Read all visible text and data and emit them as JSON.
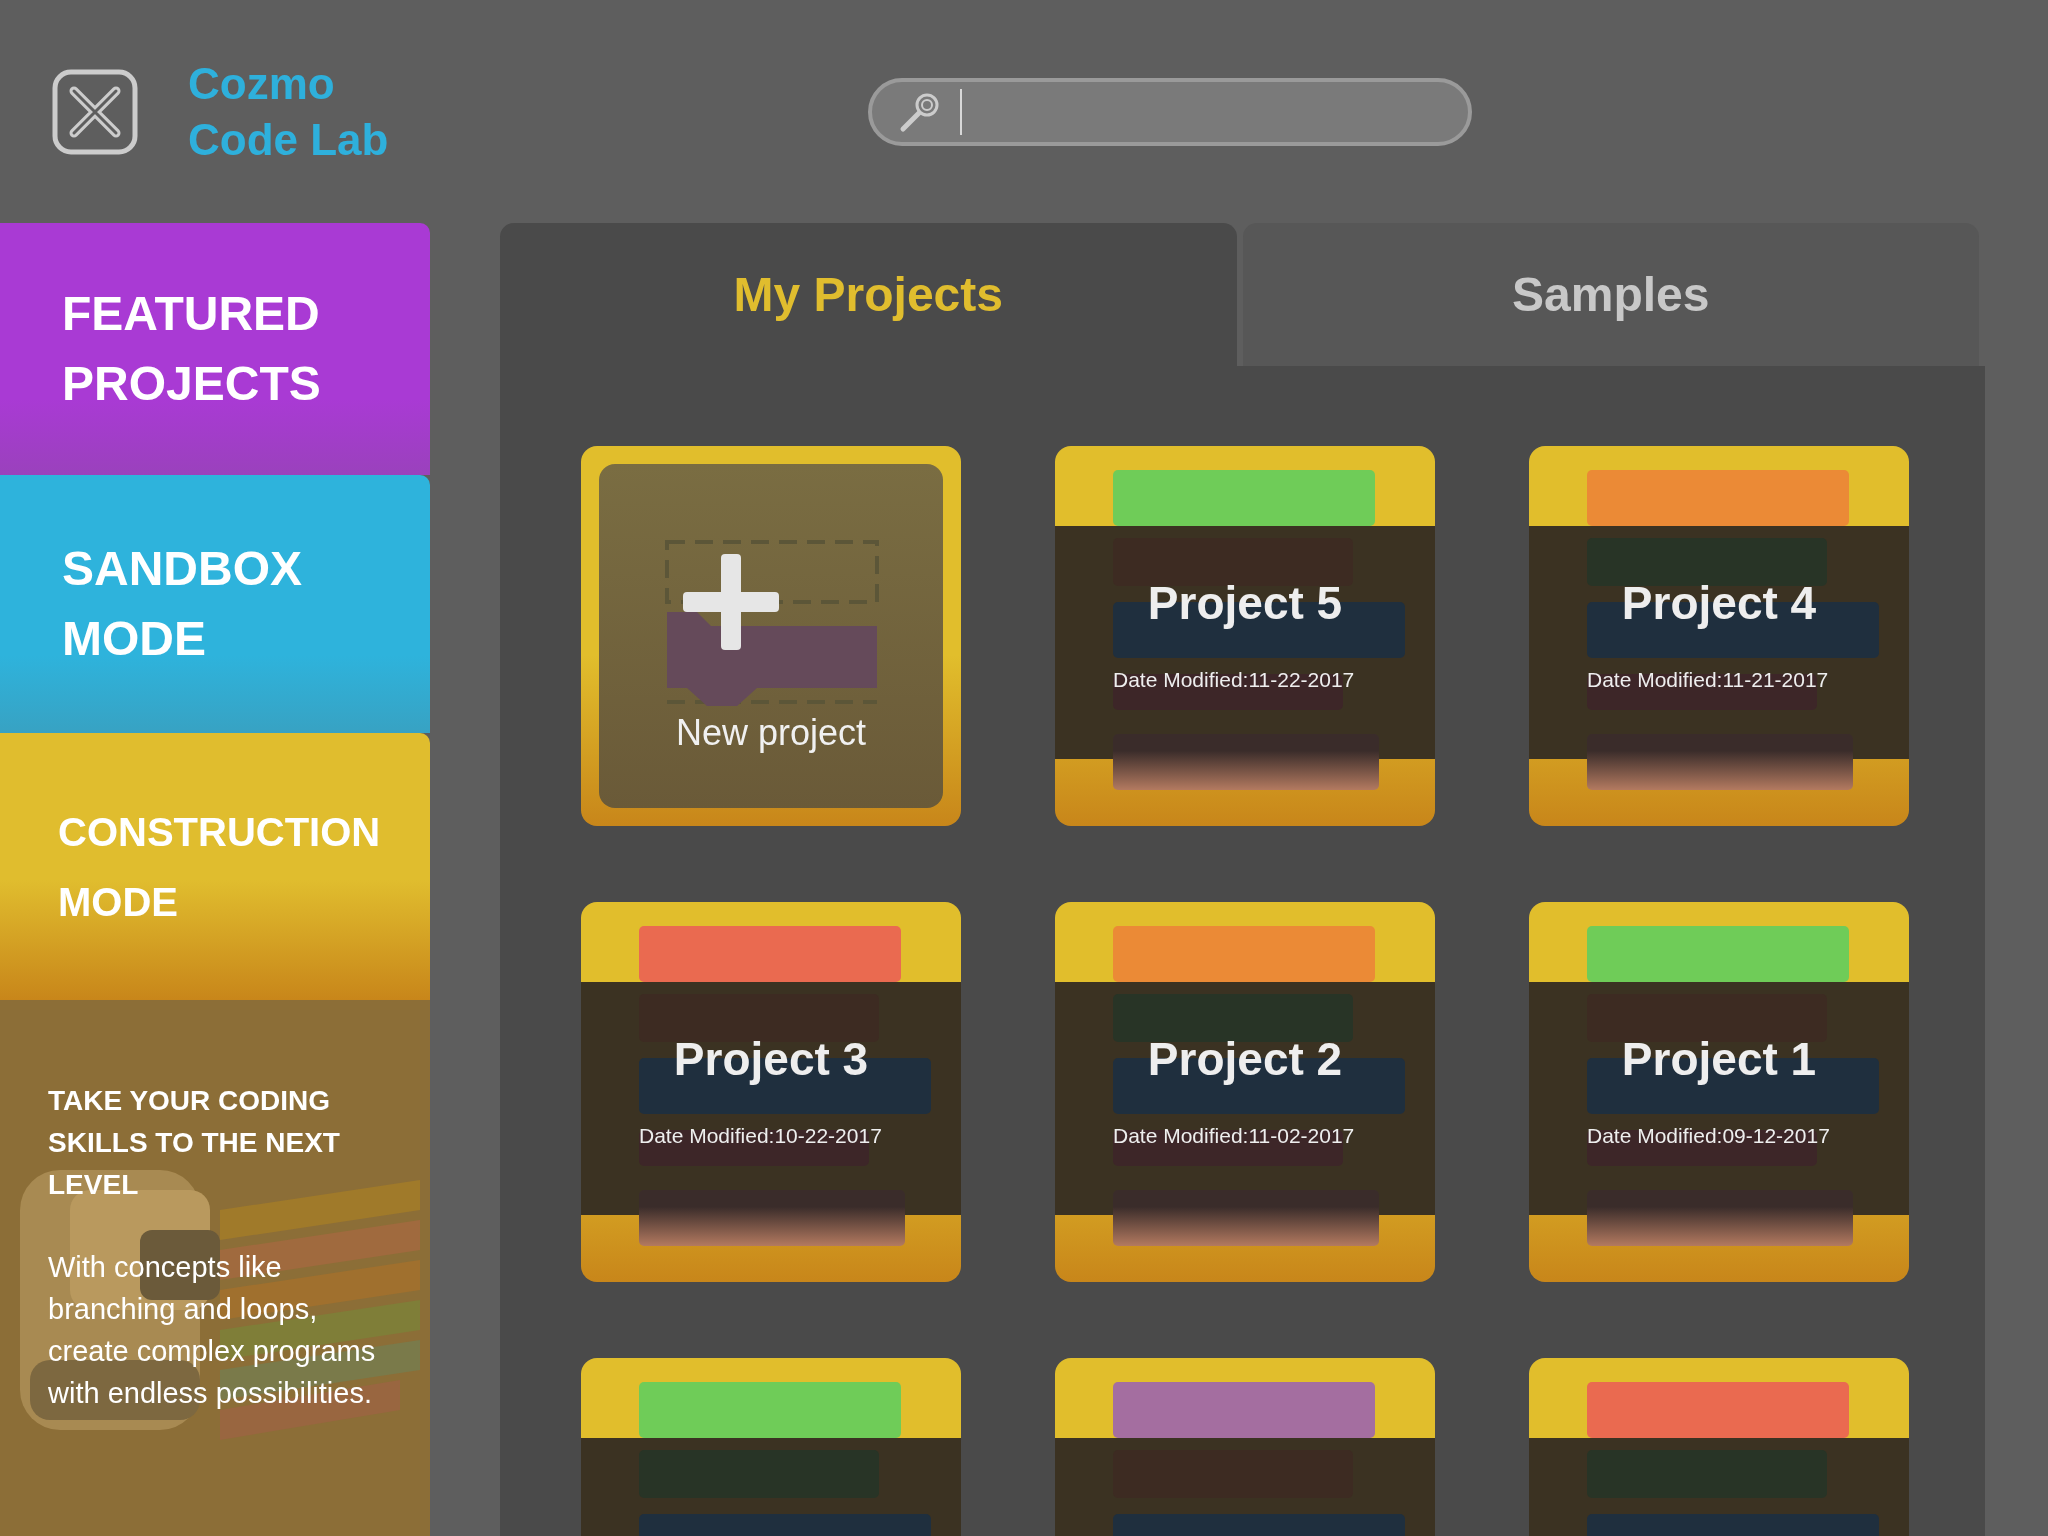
{
  "app": {
    "title_lines": [
      "Cozmo",
      "Code Lab"
    ]
  },
  "sidebar": {
    "items": [
      {
        "label_lines": [
          "FEATURED",
          "PROJECTS"
        ],
        "color": "#a93ad4"
      },
      {
        "label_lines": [
          "SANDBOX",
          "MODE"
        ],
        "color": "#2eb3dc"
      },
      {
        "label_lines": [
          "CONSTRUCTION",
          "MODE"
        ],
        "color": "#e0bd2e"
      }
    ],
    "promo": {
      "heading": "TAKE YOUR CODING SKILLS TO THE NEXT LEVEL",
      "text": "With concepts like branching and loops, create complex programs with endless possibilities."
    }
  },
  "tabs": [
    {
      "label": "My Projects",
      "selected": true
    },
    {
      "label": "Samples",
      "selected": false
    }
  ],
  "cards": [
    {
      "kind": "new",
      "label": "New project"
    },
    {
      "kind": "project",
      "title": "Project 5",
      "date": "Date Modified:11-22-2017",
      "color": "#6fcc58"
    },
    {
      "kind": "project",
      "title": "Project 4",
      "date": "Date Modified:11-21-2017",
      "color": "#eb8a36"
    },
    {
      "kind": "project",
      "title": "Project 3",
      "date": "Date Modified:10-22-2017",
      "color": "#ea6a50"
    },
    {
      "kind": "project",
      "title": "Project 2",
      "date": "Date Modified:11-02-2017",
      "color": "#eb8a36"
    },
    {
      "kind": "project",
      "title": "Project 1",
      "date": "Date Modified:09-12-2017",
      "color": "#6fcc58"
    },
    {
      "kind": "project",
      "color": "#6fcc58"
    },
    {
      "kind": "project",
      "color": "#a46ea0"
    },
    {
      "kind": "project",
      "color": "#ea6a50"
    }
  ]
}
